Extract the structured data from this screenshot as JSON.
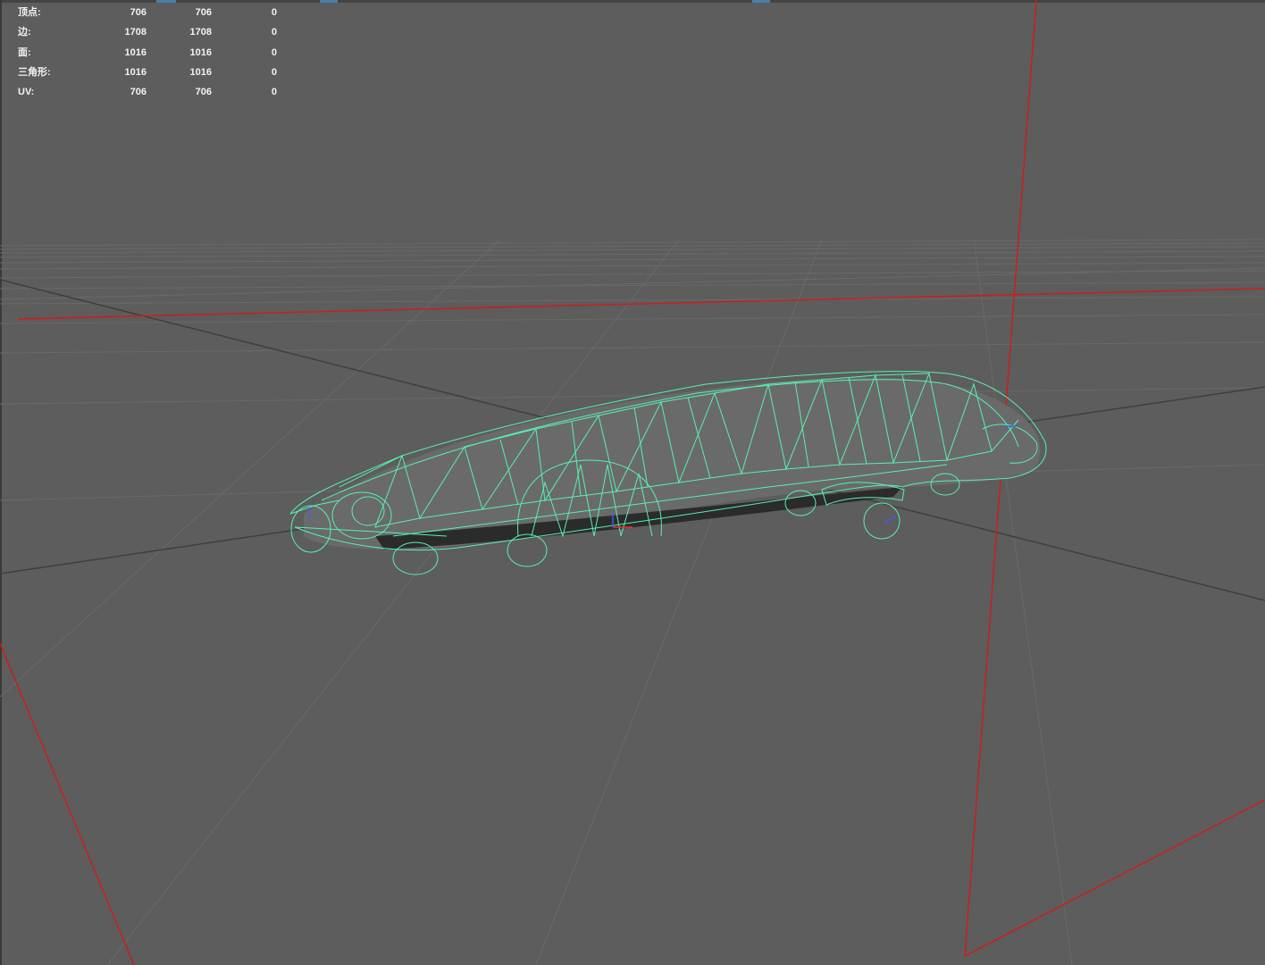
{
  "hud": {
    "rows": [
      {
        "label": "顶点:",
        "values": [
          "706",
          "706",
          "0"
        ]
      },
      {
        "label": "边:",
        "values": [
          "1708",
          "1708",
          "0"
        ]
      },
      {
        "label": "面:",
        "values": [
          "1016",
          "1016",
          "0"
        ]
      },
      {
        "label": "三角形:",
        "values": [
          "1016",
          "1016",
          "0"
        ]
      },
      {
        "label": "UV:",
        "values": [
          "706",
          "706",
          "0"
        ]
      }
    ]
  },
  "colors": {
    "viewport_bg": "#5d5d5d",
    "grid_line": "#6a6a6a",
    "grid_axis": "#3c3c3c",
    "camera_frustum": "#d21a1a",
    "wireframe": "#58f0b0",
    "hud_text": "#f2f2f2"
  },
  "icons": {
    "model": "vehicle-wireframe-mesh"
  }
}
